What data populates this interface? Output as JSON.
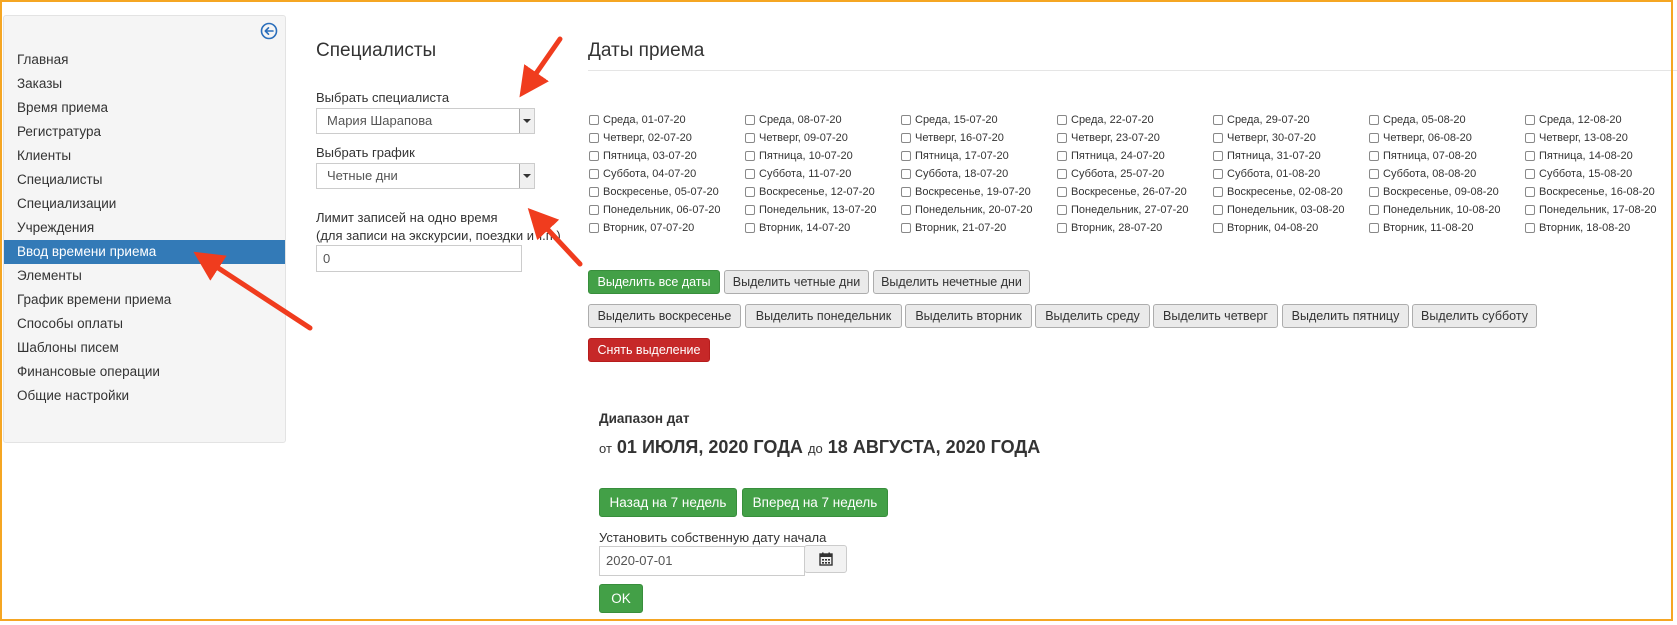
{
  "sidebar": {
    "items": [
      {
        "label": "Главная"
      },
      {
        "label": "Заказы"
      },
      {
        "label": "Время приема"
      },
      {
        "label": "Регистратура"
      },
      {
        "label": "Клиенты"
      },
      {
        "label": "Специалисты"
      },
      {
        "label": "Специализации"
      },
      {
        "label": "Учреждения"
      },
      {
        "label": "Ввод времени приема",
        "active": true
      },
      {
        "label": "Элементы"
      },
      {
        "label": "График времени приема"
      },
      {
        "label": "Способы оплаты"
      },
      {
        "label": "Шаблоны писем"
      },
      {
        "label": "Финансовые операции"
      },
      {
        "label": "Общие настройки"
      }
    ],
    "collapse_icon": "arrow-left-circle-icon",
    "accent": "#337ab7"
  },
  "specialists": {
    "title": "Специалисты",
    "select_label": "Выбрать специалиста",
    "select_value": "Мария Шарапова",
    "schedule_label": "Выбрать график",
    "schedule_value": "Четные дни",
    "limit_label_1": "Лимит записей на одно время",
    "limit_label_2": "(для записи на экскурсии, поездки и т.п.)",
    "limit_value": "0"
  },
  "dates": {
    "title": "Даты приема",
    "columns": [
      [
        "Среда, 01-07-20",
        "Четверг, 02-07-20",
        "Пятница, 03-07-20",
        "Суббота, 04-07-20",
        "Воскресенье, 05-07-20",
        "Понедельник, 06-07-20",
        "Вторник, 07-07-20"
      ],
      [
        "Среда, 08-07-20",
        "Четверг, 09-07-20",
        "Пятница, 10-07-20",
        "Суббота, 11-07-20",
        "Воскресенье, 12-07-20",
        "Понедельник, 13-07-20",
        "Вторник, 14-07-20"
      ],
      [
        "Среда, 15-07-20",
        "Четверг, 16-07-20",
        "Пятница, 17-07-20",
        "Суббота, 18-07-20",
        "Воскресенье, 19-07-20",
        "Понедельник, 20-07-20",
        "Вторник, 21-07-20"
      ],
      [
        "Среда, 22-07-20",
        "Четверг, 23-07-20",
        "Пятница, 24-07-20",
        "Суббота, 25-07-20",
        "Воскресенье, 26-07-20",
        "Понедельник, 27-07-20",
        "Вторник, 28-07-20"
      ],
      [
        "Среда, 29-07-20",
        "Четверг, 30-07-20",
        "Пятница, 31-07-20",
        "Суббота, 01-08-20",
        "Воскресенье, 02-08-20",
        "Понедельник, 03-08-20",
        "Вторник, 04-08-20"
      ],
      [
        "Среда, 05-08-20",
        "Четверг, 06-08-20",
        "Пятница, 07-08-20",
        "Суббота, 08-08-20",
        "Воскресенье, 09-08-20",
        "Понедельник, 10-08-20",
        "Вторник, 11-08-20"
      ],
      [
        "Среда, 12-08-20",
        "Четверг, 13-08-20",
        "Пятница, 14-08-20",
        "Суббота, 15-08-20",
        "Воскресенье, 16-08-20",
        "Понедельник, 17-08-20",
        "Вторник, 18-08-20"
      ]
    ]
  },
  "buttons": {
    "select_all": "Выделить все даты",
    "select_even": "Выделить четные дни",
    "select_odd": "Выделить нечетные дни",
    "select_sunday": "Выделить воскресенье",
    "select_monday": "Выделить понедельник",
    "select_tuesday": "Выделить вторник",
    "select_wednesday": "Выделить среду",
    "select_thursday": "Выделить четверг",
    "select_friday": "Выделить пятницу",
    "select_saturday": "Выделить субботу",
    "clear_selection": "Снять выделение"
  },
  "range": {
    "title": "Диапазон дат",
    "from_word": "от",
    "from_date": "01 ИЮЛЯ, 2020 ГОДА",
    "to_word": "до",
    "to_date": "18 АВГУСТА, 2020 ГОДА",
    "back_button": "Назад на 7 недель",
    "forward_button": "Вперед на 7 недель",
    "custom_start_label": "Установить собственную дату начала",
    "custom_start_value": "2020-07-01",
    "calendar_icon": "calendar-icon",
    "ok_button": "OK"
  },
  "colors": {
    "green": "#43a047",
    "red": "#c62828",
    "annotation_arrow": "#f03c1e",
    "frame": "#f5a623"
  }
}
